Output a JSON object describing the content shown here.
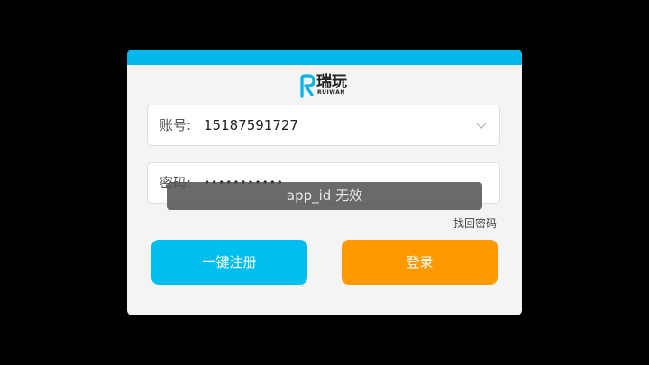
{
  "app": {
    "logo_name": "瑞玩",
    "logo_sub": "RUIWAN",
    "accent_color": "#00b9ec",
    "logo_icon": "ruiwan-r-logo-icon"
  },
  "form": {
    "account_label": "账号:",
    "account_value": "15187591727",
    "password_label": "密码:",
    "password_value": "•••••••••••",
    "dropdown_icon": "chevron-down-icon",
    "forgot_password": "找回密码"
  },
  "buttons": {
    "register_label": "一键注册",
    "register_color": "#00bff0",
    "login_label": "登录",
    "login_color": "#ff9900"
  },
  "toast": {
    "message": "app_id 无效"
  }
}
